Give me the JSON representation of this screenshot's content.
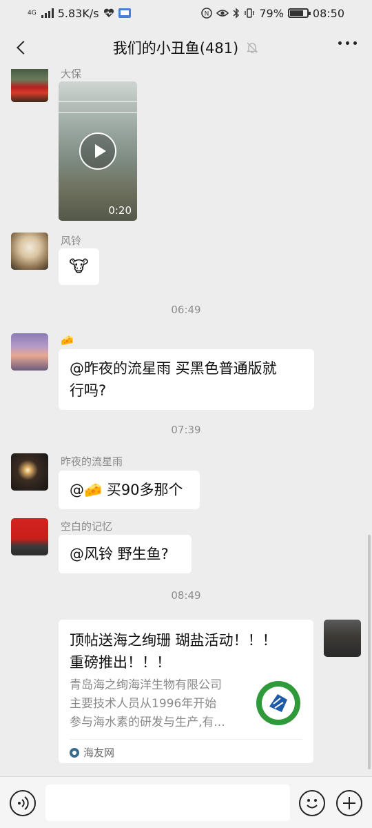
{
  "status_bar": {
    "network_type": "4G",
    "speed": "5.83K/s",
    "battery_percent": "79%",
    "battery_level": 0.79,
    "time": "08:50"
  },
  "header": {
    "title": "我们的小丑鱼(481)",
    "icons": [
      "back-arrow-icon",
      "mute-bell-icon",
      "more-dots-icon"
    ]
  },
  "messages": [
    {
      "sender": "大保",
      "type": "video",
      "duration": "0:20"
    },
    {
      "sender": "风铃",
      "type": "sticker",
      "emoji": "🐮"
    },
    {
      "type": "time",
      "text": "06:49"
    },
    {
      "sender": "🧀",
      "type": "text",
      "lines": [
        "@昨夜的流星雨  买黑色普通版就",
        "行吗?"
      ]
    },
    {
      "type": "time",
      "text": "07:39"
    },
    {
      "sender": "昨夜的流星雨",
      "type": "text",
      "lines": [
        "@🧀 买90多那个"
      ]
    },
    {
      "sender": "空白的记忆",
      "type": "text",
      "lines": [
        "@风铃  野生鱼?"
      ]
    },
    {
      "type": "time",
      "text": "08:49"
    },
    {
      "sender": "self",
      "type": "link",
      "title_lines": [
        "顶帖送海之绚珊 瑚盐活动！！！",
        "重磅推出！！！"
      ],
      "desc_lines": [
        "青岛海之绚海洋生物有限公司",
        "主要技术人员从1996年开始",
        "参与海水素的研发与生产,有..."
      ],
      "source": "海友网"
    }
  ],
  "input_bar": {
    "icons": [
      "voice-icon",
      "emoji-icon",
      "plus-icon"
    ]
  }
}
